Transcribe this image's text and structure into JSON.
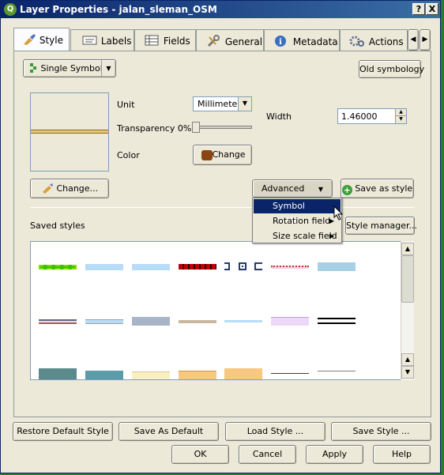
{
  "window": {
    "title": "Layer Properties - jalan_sleman_OSM",
    "help_btn": "?",
    "close_btn": "X"
  },
  "tabs": [
    {
      "label": "Style",
      "icon": "brush-icon"
    },
    {
      "label": "Labels",
      "icon": "labels-icon"
    },
    {
      "label": "Fields",
      "icon": "table-icon"
    },
    {
      "label": "General",
      "icon": "wrench-icon"
    },
    {
      "label": "Metadata",
      "icon": "info-icon"
    },
    {
      "label": "Actions",
      "icon": "gears-icon"
    }
  ],
  "style": {
    "renderer_value": "Single Symbol",
    "old_symbology": "Old symbology",
    "unit_label": "Unit",
    "unit_value": "Millimeter",
    "transparency_label": "Transparency 0%",
    "transparency_value": 0,
    "color_label": "Color",
    "color_change": "Change",
    "width_label": "Width",
    "width_value": "1.46000",
    "symbol_change": "Change...",
    "advanced": "Advanced",
    "save_as_style": "Save as style",
    "saved_styles_label": "Saved styles",
    "style_manager": "Style manager...",
    "line_color": "#e8c870",
    "color_swatch": "#8b4513"
  },
  "advanced_menu": [
    {
      "label": "Symbol levels...",
      "selected": true,
      "submenu": false
    },
    {
      "label": "Rotation field",
      "selected": false,
      "submenu": true
    },
    {
      "label": "Size scale field",
      "selected": false,
      "submenu": true
    }
  ],
  "footer": {
    "restore_default": "Restore Default Style",
    "save_as_default": "Save As Default",
    "load_style": "Load Style ...",
    "save_style": "Save Style ...",
    "ok": "OK",
    "cancel": "Cancel",
    "apply": "Apply",
    "help": "Help"
  }
}
